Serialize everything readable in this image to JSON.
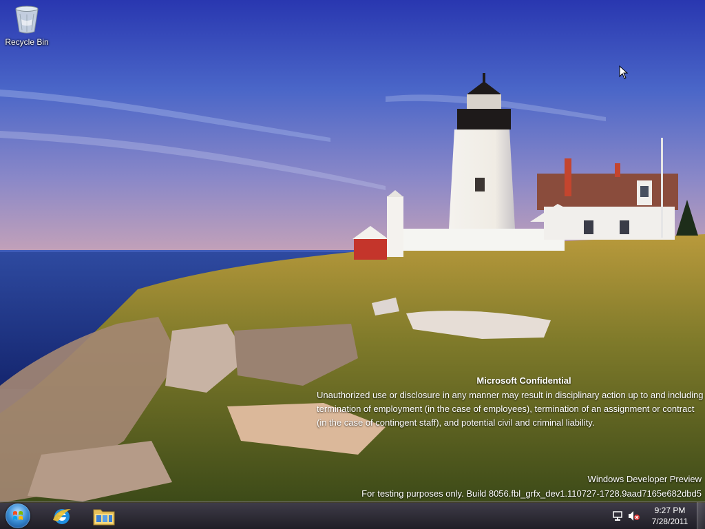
{
  "desktop": {
    "icons": [
      {
        "label": "Recycle Bin",
        "icon": "recycle-bin-icon"
      }
    ]
  },
  "watermark": {
    "title": "Microsoft Confidential",
    "body": "Unauthorized use or disclosure in any manner may result in disciplinary action up to and including termination of employment (in the case of employees), termination of an assignment or contract (in the case of contingent staff), and potential civil and criminal liability.",
    "edition": "Windows Developer Preview",
    "build": "For testing purposes only. Build 8056.fbl_grfx_dev1.110727-1728.9aad7165e682dbd5"
  },
  "taskbar": {
    "start_icon": "windows-start-orb-icon",
    "pinned": [
      {
        "name": "Internet Explorer",
        "icon": "internet-explorer-icon"
      },
      {
        "name": "Windows Explorer",
        "icon": "file-explorer-icon"
      }
    ],
    "tray": {
      "network_icon": "network-icon",
      "volume_icon": "volume-muted-icon",
      "time": "9:27 PM",
      "date": "7/28/2011"
    }
  },
  "colors": {
    "sky_top": "#2f3fa8",
    "sea": "#233a8a",
    "grass": "#8a8a30"
  }
}
